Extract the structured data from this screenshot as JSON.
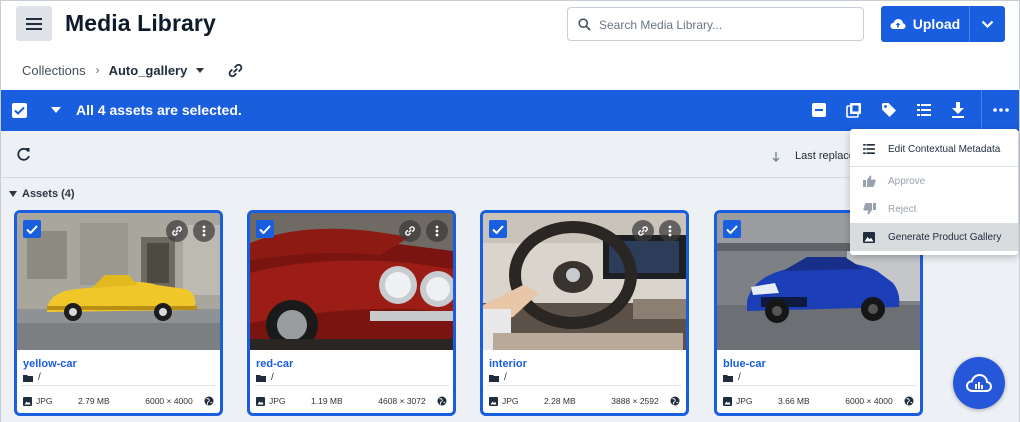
{
  "header": {
    "title": "Media Library",
    "search_placeholder": "Search Media Library...",
    "upload_label": "Upload"
  },
  "breadcrumb": {
    "root": "Collections",
    "current": "Auto_gallery"
  },
  "selection_bar": {
    "message": "All 4 assets are selected."
  },
  "toolbar": {
    "sort_label": "Last replaced"
  },
  "assets_section": {
    "label": "Assets (4)"
  },
  "assets": [
    {
      "name": "yellow-car",
      "folder": "/",
      "format": "JPG",
      "size": "2.79 MB",
      "dimensions": "6000 × 4000"
    },
    {
      "name": "red-car",
      "folder": "/",
      "format": "JPG",
      "size": "1.19 MB",
      "dimensions": "4608 × 3072"
    },
    {
      "name": "interior",
      "folder": "/",
      "format": "JPG",
      "size": "2.28 MB",
      "dimensions": "3888 × 2592"
    },
    {
      "name": "blue-car",
      "folder": "/",
      "format": "JPG",
      "size": "3.66 MB",
      "dimensions": "6000 × 4000"
    }
  ],
  "menu": {
    "items": [
      {
        "label": "Edit Contextual Metadata",
        "enabled": true
      },
      {
        "label": "Approve",
        "enabled": false
      },
      {
        "label": "Reject",
        "enabled": false
      },
      {
        "label": "Generate Product Gallery",
        "enabled": true,
        "highlighted": true
      }
    ]
  },
  "colors": {
    "accent": "#1a5ee0",
    "selection_bar": "#1a5ee0",
    "content_bg": "#edf0f4",
    "fab": "#2557d8"
  },
  "icons": [
    "hamburger-menu-icon",
    "search-icon",
    "cloud-upload-icon",
    "chevron-down-icon",
    "caret-down-icon",
    "link-icon",
    "checkbox-checked-icon",
    "deselect-icon",
    "add-to-collection-icon",
    "tag-icon",
    "metadata-icon",
    "download-icon",
    "more-horizontal-icon",
    "refresh-icon",
    "arrow-down-icon",
    "triangle-down-icon",
    "more-vertical-icon",
    "folder-icon",
    "image-file-icon",
    "globe-icon",
    "thumbs-up-icon",
    "thumbs-down-icon",
    "gallery-icon",
    "cloud-icon"
  ]
}
